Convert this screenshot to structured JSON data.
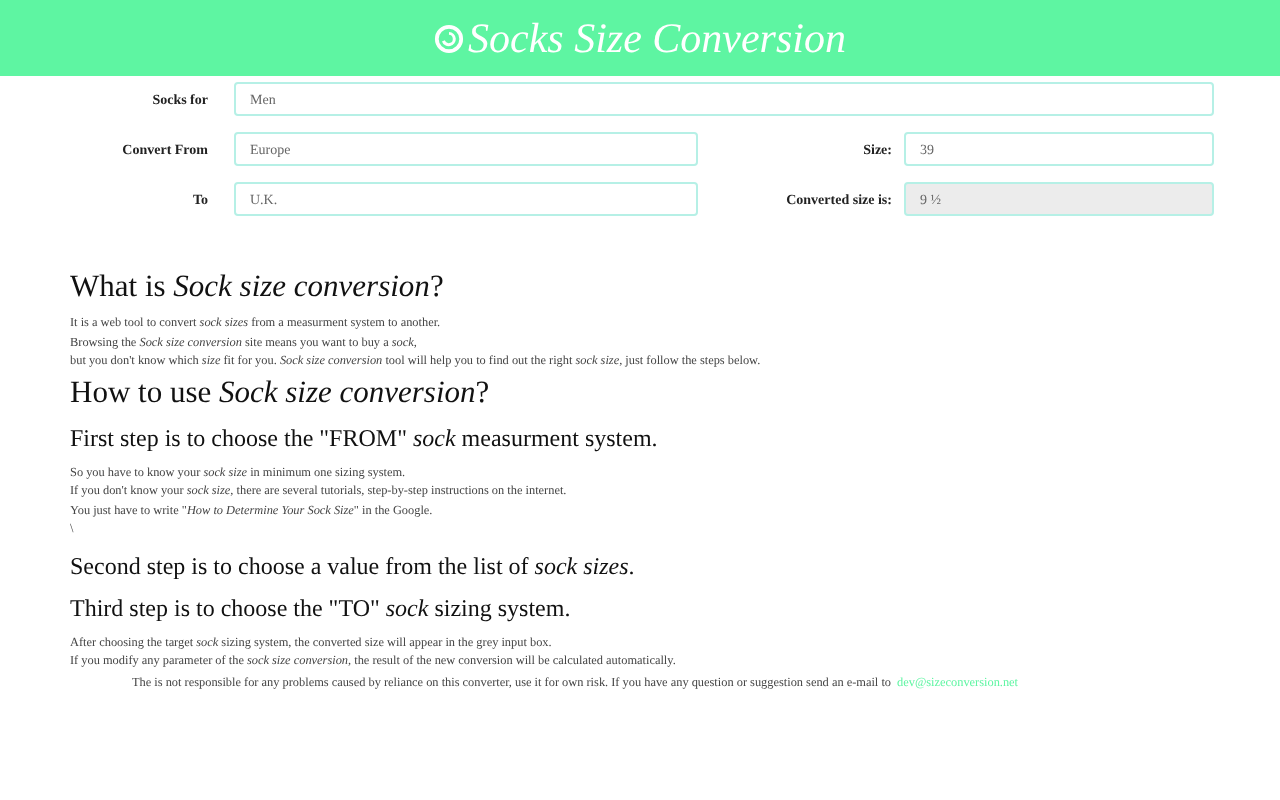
{
  "header": {
    "title": "Socks Size Conversion"
  },
  "form": {
    "rows": [
      {
        "label": "Socks for",
        "value": "Men"
      },
      {
        "label": "Convert From",
        "value": "Europe",
        "side_label": "Size:",
        "side_value": "39",
        "side_disabled": false
      },
      {
        "label": "To",
        "value": "U.K.",
        "side_label": "Converted size is:",
        "side_value": "9 ½",
        "side_disabled": true
      }
    ]
  },
  "content": [
    {
      "kind": "h1",
      "text": "What is *Sock size conversion*?"
    },
    {
      "kind": "p",
      "text": "It is a web tool to convert *sock sizes* from a measurment system to another."
    },
    {
      "kind": "p",
      "text": "Browsing the *Sock size conversion* site means you want to buy a *sock*,"
    },
    {
      "kind": "p",
      "text": "but you don't know which *size* fit for you. *Sock size conversion* tool will help you to find out the right *sock size*, just follow the steps below."
    },
    {
      "kind": "h1",
      "text": "How to use *Sock size conversion*?"
    },
    {
      "kind": "h2",
      "text": "First step is to choose the \"FROM\" *sock* measurment system."
    },
    {
      "kind": "p",
      "text": "So you have to know your *sock size* in minimum one sizing system."
    },
    {
      "kind": "p",
      "text": "If you don't know your *sock size*, there are several tutorials, step-by-step instructions on the internet."
    },
    {
      "kind": "p",
      "text": "You just have to write \"*How to Determine Your Sock Size*\" in the Google."
    },
    {
      "kind": "p",
      "text": "\\"
    },
    {
      "kind": "h2",
      "text": "Second step is to choose a value from the list of *sock sizes*."
    },
    {
      "kind": "h2",
      "text": "Third step is to choose the \"TO\" *sock* sizing system."
    },
    {
      "kind": "p",
      "text": "After choosing the target *sock* sizing system, the converted size will appear in the grey input box."
    },
    {
      "kind": "p",
      "text": "If you modify any parameter of the *sock size conversion*, the result of the new conversion will be calculated automatically."
    }
  ],
  "footer": {
    "text": "The is not responsible for any problems caused by reliance on this converter, use it for own risk. If you have any question or suggestion send an e-mail to",
    "link": "dev@sizeconversion.net"
  }
}
